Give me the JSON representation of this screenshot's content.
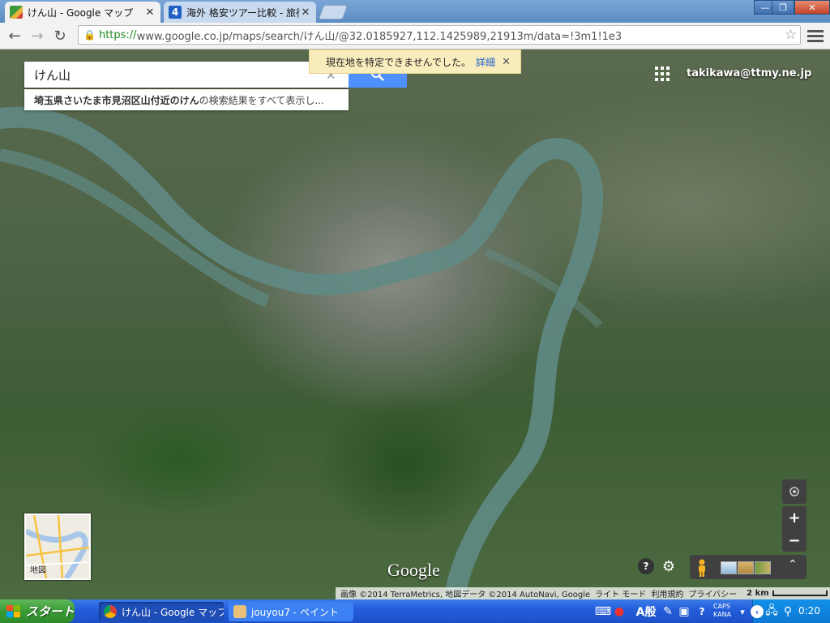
{
  "browser": {
    "tabs": [
      {
        "title": "けん山 - Google マップ",
        "active": true
      },
      {
        "title": "海外 格安ツアー比較 - 旅行",
        "active": false
      }
    ],
    "window_buttons": {
      "minimize": "—",
      "maximize": "❐",
      "close": "✕"
    },
    "nav": {
      "back": "←",
      "forward": "→",
      "reload": "↻"
    },
    "url": {
      "scheme": "https://",
      "rest": "www.google.co.jp/maps/search/けん山/@32.0185927,112.1425989,21913m/data=!3m1!1e3"
    }
  },
  "maps": {
    "search_value": "けん山",
    "suggestion_bold": "埼玉県さいたま市見沼区山付近のけん",
    "suggestion_rest": "の検索結果をすべて表示し...",
    "notice_text": "現在地を特定できませんでした。",
    "notice_link": "詳細",
    "user": "takikawa@ttmy.ne.jp",
    "minimap_label": "地図",
    "logo": "Google",
    "zoom_in": "+",
    "zoom_out": "−",
    "footer": {
      "imagery": "画像 ©2014 TerraMetrics, 地図データ ©2014 AutoNavi, Google",
      "lite": "ライト モード",
      "terms": "利用規約",
      "privacy": "プライバシー",
      "scale": "2 km"
    }
  },
  "taskbar": {
    "start": "スタート",
    "tasks": [
      {
        "title": "けん山 - Google マップ..."
      },
      {
        "title": "jouyou7 - ペイント"
      }
    ],
    "ime": "A般",
    "caps": "CAPS",
    "kana": "KANA",
    "clock": "0:20"
  },
  "colors": {
    "search_button": "#4d90fe",
    "notice_bg": "#f9edbe",
    "river": "#5f8a84",
    "taskbar": "#245edb",
    "start": "#3a9a35"
  }
}
